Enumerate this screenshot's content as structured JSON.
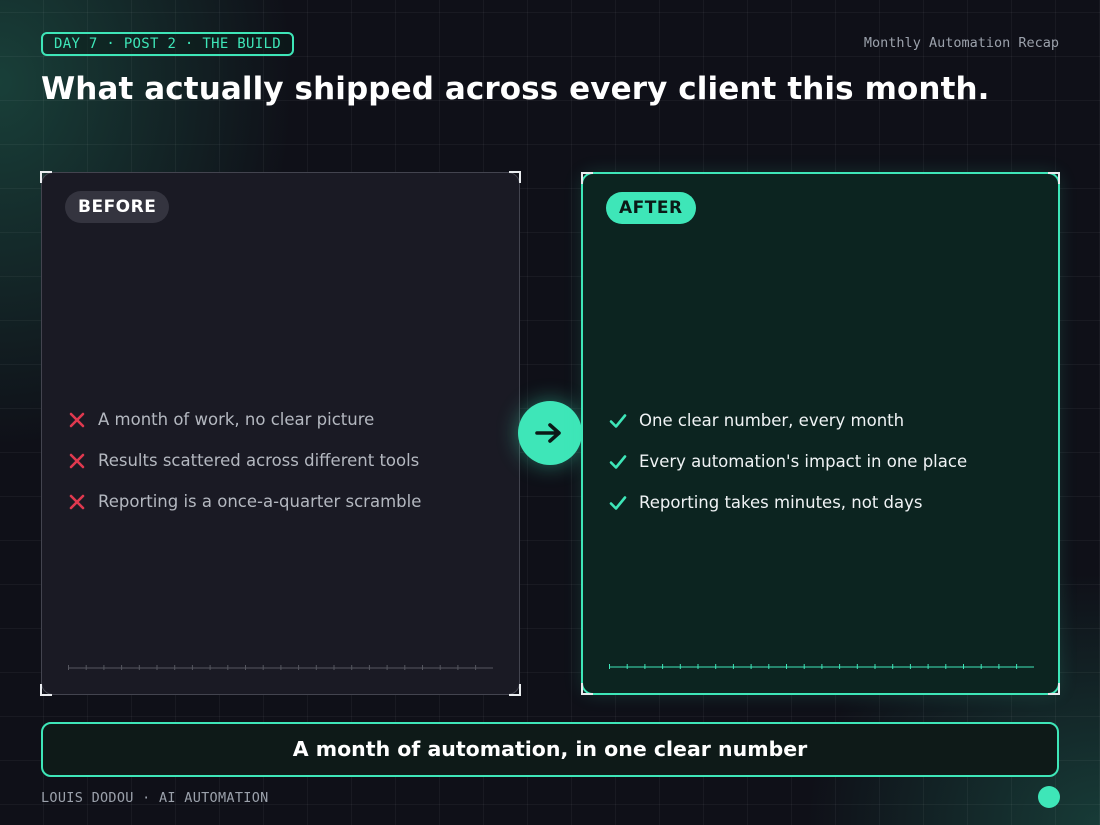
{
  "header": {
    "tag": "DAY 7 · POST 2 · THE BUILD",
    "recap": "Monthly Automation Recap",
    "headline": "What actually shipped across every client this month."
  },
  "before": {
    "label": "BEFORE",
    "icon": "x-icon",
    "items": [
      "A month of work, no clear picture",
      "Results scattered across different tools",
      "Reporting is a once-a-quarter scramble"
    ]
  },
  "after": {
    "label": "AFTER",
    "icon": "check-icon",
    "items": [
      "One clear number, every month",
      "Every automation's impact in one place",
      "Reporting takes minutes, not days"
    ]
  },
  "transition_icon": "arrow-right-icon",
  "banner": "A month of automation, in one clear number",
  "footer": {
    "author": "LOUIS DODOU · AI AUTOMATION"
  },
  "colors": {
    "accent": "#3ee6b8",
    "negative": "#e0394f",
    "background": "#0f1018"
  }
}
